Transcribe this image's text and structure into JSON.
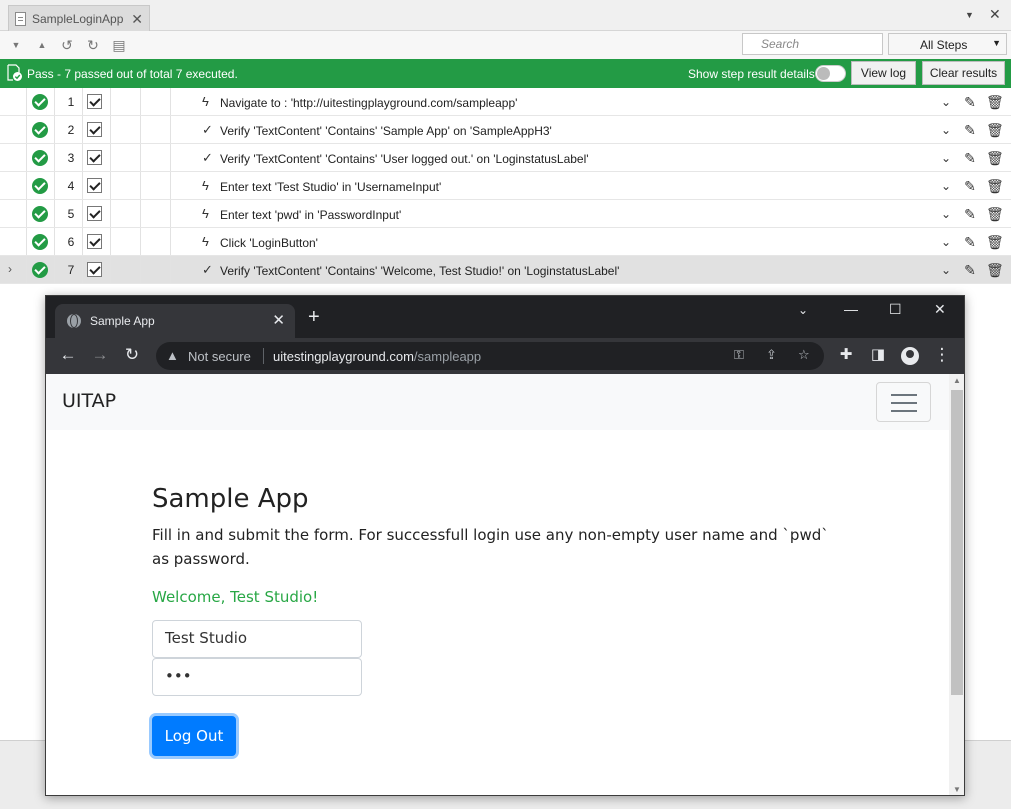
{
  "test_studio": {
    "tab_title": "SampleLoginApp",
    "search_placeholder": "Search",
    "steps_filter": "All Steps",
    "status": "Pass - 7 passed out of total 7 executed.",
    "show_step_details": "Show step result details",
    "view_log": "View log",
    "clear_results": "Clear results",
    "accent_color": "#239b45",
    "steps": [
      {
        "num": "1",
        "type": "action",
        "desc": "Navigate to : 'http://uitestingplayground.com/sampleapp'"
      },
      {
        "num": "2",
        "type": "verification",
        "desc": "Verify 'TextContent' 'Contains' 'Sample App' on 'SampleAppH3'"
      },
      {
        "num": "3",
        "type": "verification",
        "desc": "Verify 'TextContent' 'Contains' 'User logged out.' on 'LoginstatusLabel'"
      },
      {
        "num": "4",
        "type": "action",
        "desc": "Enter text 'Test Studio' in 'UsernameInput'"
      },
      {
        "num": "5",
        "type": "action",
        "desc": "Enter text 'pwd' in 'PasswordInput'"
      },
      {
        "num": "6",
        "type": "action",
        "desc": "Click 'LoginButton'"
      },
      {
        "num": "7",
        "type": "verification",
        "desc": "Verify 'TextContent' 'Contains' 'Welcome, Test Studio!' on 'LoginstatusLabel'"
      }
    ]
  },
  "browser": {
    "tab_title": "Sample App",
    "security": "Not secure",
    "url_host": "uitestingplayground.com",
    "url_path": "/sampleapp"
  },
  "page": {
    "brand": "UITAP",
    "heading": "Sample App",
    "intro": "Fill in and submit the form. For successfull login use any non-empty user name and `pwd` as password.",
    "login_status": "Welcome, Test Studio!",
    "username_value": "Test Studio",
    "password_value": "•••",
    "button_label": "Log Out"
  }
}
